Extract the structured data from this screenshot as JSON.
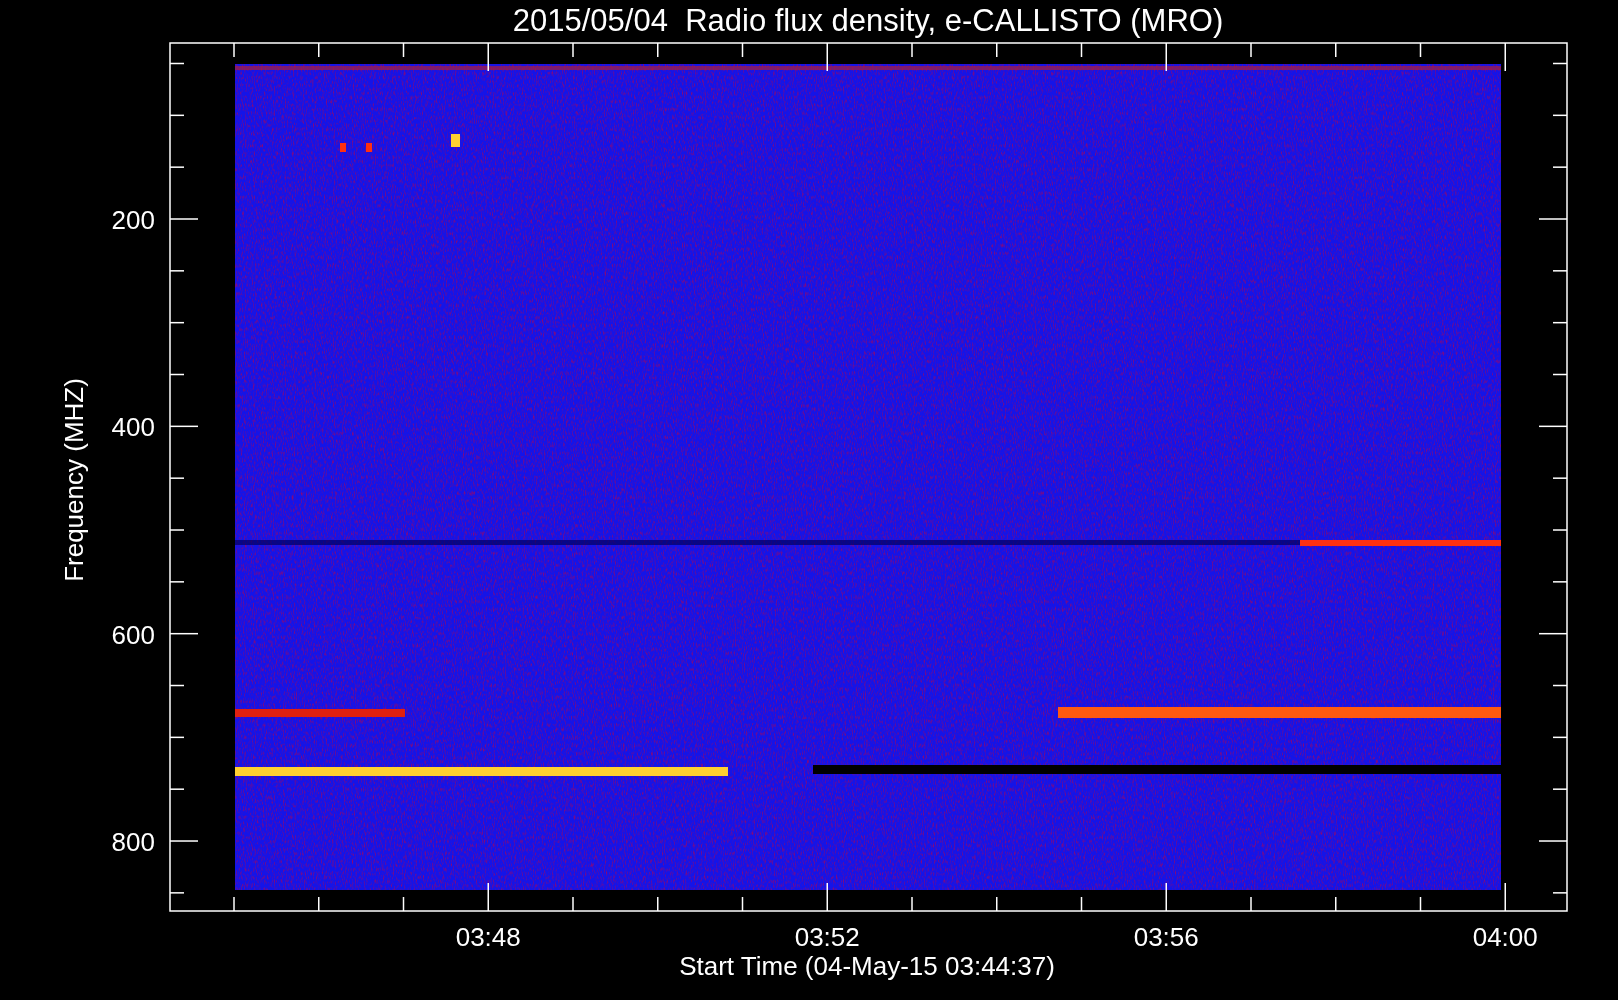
{
  "title": "2015/05/04  Radio flux density, e-CALLISTO (MRO)",
  "y_axis": {
    "label": "Frequency (MHZ)",
    "ticks": [
      "200",
      "400",
      "600",
      "800"
    ]
  },
  "x_axis": {
    "label": "Start Time (04-May-15 03:44:37)",
    "ticks": [
      "03:48",
      "03:52",
      "03:56",
      "04:00"
    ]
  }
}
